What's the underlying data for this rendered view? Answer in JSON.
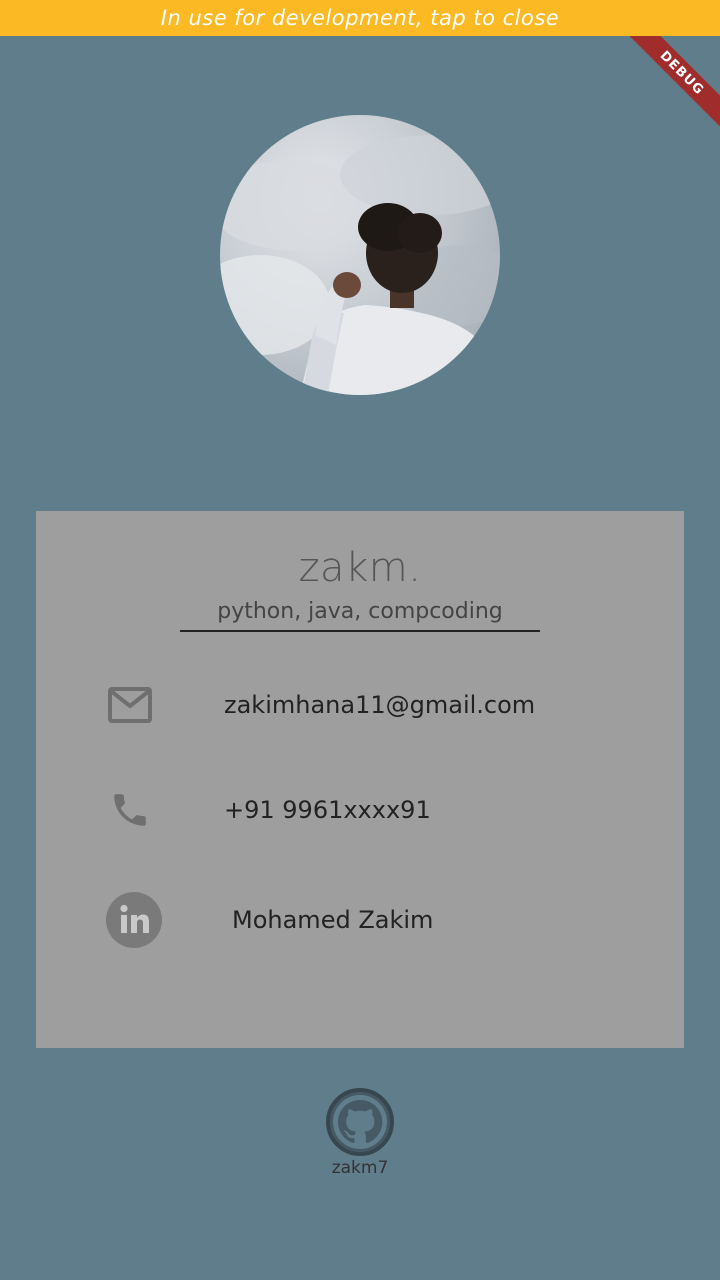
{
  "banner": {
    "text": "In use for development, tap to close",
    "color": "#fbb924"
  },
  "debug_ribbon": {
    "label": "DEBUG",
    "color": "#a12c2c"
  },
  "profile": {
    "name": "zakm.",
    "skills": "python, java, compcoding",
    "avatar_icon": "profile-photo"
  },
  "contacts": {
    "email": {
      "icon": "mail-icon",
      "value": "zakimhana11@gmail.com"
    },
    "phone": {
      "icon": "phone-icon",
      "value": "+91 9961xxxx91"
    },
    "linkedin": {
      "icon": "linkedin-icon",
      "value": "Mohamed Zakim"
    }
  },
  "github": {
    "icon": "github-icon",
    "username": "zakm7"
  },
  "colors": {
    "background": "#607d8b",
    "card": "#9e9e9e",
    "icon": "#6f6f6f"
  }
}
